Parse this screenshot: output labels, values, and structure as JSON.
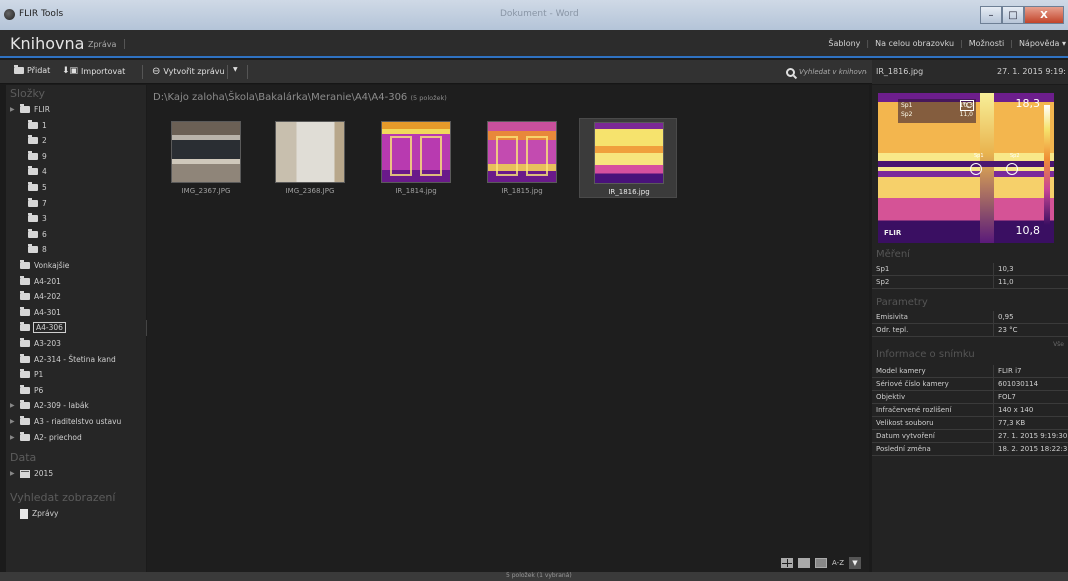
{
  "window": {
    "title": "FLIR Tools",
    "subtitle": "Dokument - Word",
    "min": "–",
    "max": "□",
    "close": "X"
  },
  "header": {
    "section": "Knihovna",
    "sub": "Zpráva",
    "menu": [
      "Šablony",
      "Na celou obrazovku",
      "Možnosti",
      "Nápověda ▾"
    ]
  },
  "toolbar": {
    "add": "Přidat",
    "import": "Importovat",
    "create_report": "Vytvořit zprávu",
    "dropdown": "▼",
    "search_placeholder": "Vyhledat v knihovně"
  },
  "selected_file": {
    "name": "IR_1816.jpg",
    "date": "27. 1. 2015 9:19:"
  },
  "sidebar": {
    "folders_head": "Složky",
    "folders": [
      {
        "label": "FLIR",
        "arrow": true
      },
      {
        "label": "1"
      },
      {
        "label": "2"
      },
      {
        "label": "9"
      },
      {
        "label": "4"
      },
      {
        "label": "5"
      },
      {
        "label": "7"
      },
      {
        "label": "3"
      },
      {
        "label": "6"
      },
      {
        "label": "8"
      },
      {
        "label": "Vonkajšie"
      },
      {
        "label": "A4-201"
      },
      {
        "label": "A4-202"
      },
      {
        "label": "A4-301"
      },
      {
        "label": "A4-306",
        "selected": true
      },
      {
        "label": "A3-203"
      },
      {
        "label": "A2-314 - Štetina kand"
      },
      {
        "label": "P1"
      },
      {
        "label": "P6"
      },
      {
        "label": "A2-309 - labák",
        "arrow": true
      },
      {
        "label": "A3 - riaditelstvo ustavu",
        "arrow": true
      },
      {
        "label": "A2- priechod",
        "arrow": true
      }
    ],
    "dates_head": "Data",
    "dates": [
      {
        "label": "2015",
        "arrow": true
      }
    ],
    "views_head": "Vyhledat zobrazení",
    "views": [
      {
        "label": "Zprávy"
      }
    ]
  },
  "gallery": {
    "path": "D:\\Kajo zaloha\\Škola\\Bakalárka\\Meranie\\A4\\A4-306",
    "count": "(5 položek)",
    "items": [
      {
        "name": "IMG_2367.JPG",
        "kind": "photo1"
      },
      {
        "name": "IMG_2368.JPG",
        "kind": "photo2"
      },
      {
        "name": "IR_1814.jpg",
        "kind": "ir1"
      },
      {
        "name": "IR_1815.jpg",
        "kind": "ir2"
      },
      {
        "name": "IR_1816.jpg",
        "kind": "ir3",
        "selected": true
      }
    ],
    "sort_label": "A-Z",
    "sort_drop": "▼"
  },
  "preview": {
    "sp1_label": "Sp1",
    "sp1_value": "10,3",
    "sp2_label": "Sp2",
    "sp2_value": "11,0",
    "unit": "°C",
    "max": "18,3",
    "min": "10,8",
    "brand": "FLIR",
    "sp1_tag": "Sp1",
    "sp2_tag": "Sp2"
  },
  "measurements": {
    "head": "Měření",
    "rows": [
      {
        "k": "Sp1",
        "v": "10,3"
      },
      {
        "k": "Sp2",
        "v": "11,0"
      }
    ]
  },
  "parameters": {
    "head": "Parametry",
    "rows": [
      {
        "k": "Emisivita",
        "v": "0,95"
      },
      {
        "k": "Odr. tepl.",
        "v": "23 °C"
      }
    ],
    "more": "Vše"
  },
  "image_info": {
    "head": "Informace o snímku",
    "rows": [
      {
        "k": "Model kamery",
        "v": "FLIR i7"
      },
      {
        "k": "Sériové číslo kamery",
        "v": "601030114"
      },
      {
        "k": "Objektiv",
        "v": "FOL7"
      },
      {
        "k": "Infračervené rozlišení",
        "v": "140 x 140"
      },
      {
        "k": "Velikost souboru",
        "v": "77,3 KB"
      },
      {
        "k": "Datum vytvoření",
        "v": "27. 1. 2015 9:19:30"
      },
      {
        "k": "Poslední změna",
        "v": "18. 2. 2015 18:22:3"
      }
    ]
  },
  "status": "5 položek (1 vybraná)"
}
